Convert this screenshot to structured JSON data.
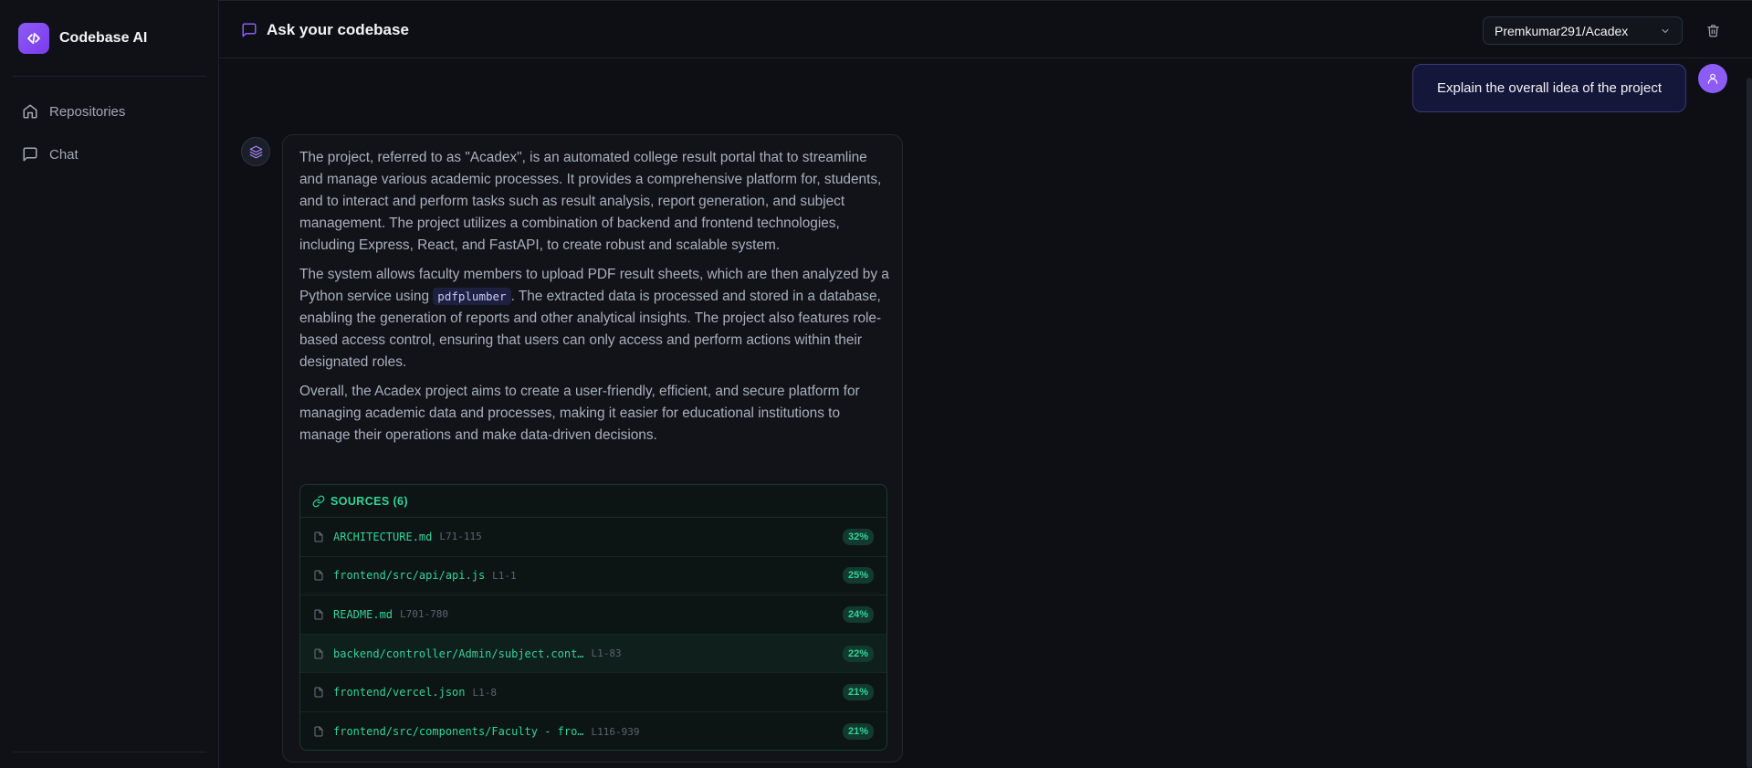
{
  "sidebar": {
    "brand": "Codebase AI",
    "items": [
      {
        "label": "Repositories",
        "icon": "home-icon"
      },
      {
        "label": "Chat",
        "icon": "message-square-icon"
      }
    ]
  },
  "header": {
    "title": "Ask your codebase",
    "repo_selected": "Premkumar291/Acadex"
  },
  "chat": {
    "user_message": "Explain the overall idea of the project",
    "bot": {
      "p1": "The project, referred to as \"Acadex\", is an automated college result portal that to streamline and manage various academic processes. It provides a comprehensive platform for, students, and to interact and perform tasks such as result analysis, report generation, and subject management. The project utilizes a combination of backend and frontend technologies, including Express, React, and FastAPI, to create robust and scalable system.",
      "p2_before": "The system allows faculty members to upload PDF result sheets, which are then analyzed by a Python service using",
      "p2_code": "pdfplumber",
      "p2_after": ". The extracted data is processed and stored in a database, enabling the generation of reports and other analytical insights. The project also features role-based access control, ensuring that users can only access and perform actions within their designated roles.",
      "p3": "Overall, the Acadex project aims to create a user-friendly, efficient, and secure platform for managing academic data and processes, making it easier for educational institutions to manage their operations and make data-driven decisions."
    },
    "sources_label": "SOURCES (6)",
    "sources": [
      {
        "name": "ARCHITECTURE.md",
        "lines": "L71-115",
        "pct": "32%"
      },
      {
        "name": "frontend/src/api/api.js",
        "lines": "L1-1",
        "pct": "25%"
      },
      {
        "name": "README.md",
        "lines": "L701-780",
        "pct": "24%"
      },
      {
        "name": "backend/controller/Admin/subject.cont…",
        "lines": "L1-83",
        "pct": "22%"
      },
      {
        "name": "frontend/vercel.json",
        "lines": "L1-8",
        "pct": "21%"
      },
      {
        "name": "frontend/src/components/Faculty - fro…",
        "lines": "L116-939",
        "pct": "21%"
      }
    ]
  },
  "colors": {
    "accent": "#8b5cf6",
    "source_green": "#34d399",
    "background": "#0d0f15"
  }
}
